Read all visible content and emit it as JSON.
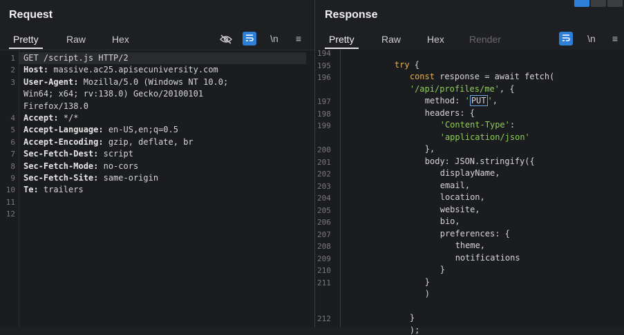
{
  "request": {
    "title": "Request",
    "tabs": [
      "Pretty",
      "Raw",
      "Hex"
    ],
    "active_tab": "Pretty",
    "toolbar": {
      "wrap_label": "\\n",
      "menu": "≡",
      "hide_icon": "eye-off-icon",
      "format_icon": "format-icon"
    },
    "lines": [
      {
        "n": "1",
        "key": "",
        "rest": "GET /script.js HTTP/2"
      },
      {
        "n": "2",
        "key": "Host:",
        "rest": " massive.ac25.apisecuniversity.com"
      },
      {
        "n": "3",
        "key": "User-Agent:",
        "rest": " Mozilla/5.0 (Windows NT 10.0;"
      },
      {
        "n": "",
        "key": "",
        "rest": "Win64; x64; rv:138.0) Gecko/20100101"
      },
      {
        "n": "",
        "key": "",
        "rest": "Firefox/138.0"
      },
      {
        "n": "4",
        "key": "Accept:",
        "rest": " */*"
      },
      {
        "n": "5",
        "key": "Accept-Language:",
        "rest": " en-US,en;q=0.5"
      },
      {
        "n": "6",
        "key": "Accept-Encoding:",
        "rest": " gzip, deflate, br"
      },
      {
        "n": "7",
        "key": "Sec-Fetch-Dest:",
        "rest": " script"
      },
      {
        "n": "8",
        "key": "Sec-Fetch-Mode:",
        "rest": " no-cors"
      },
      {
        "n": "9",
        "key": "Sec-Fetch-Site:",
        "rest": " same-origin"
      },
      {
        "n": "10",
        "key": "Te:",
        "rest": " trailers"
      },
      {
        "n": "11",
        "key": "",
        "rest": ""
      },
      {
        "n": "12",
        "key": "",
        "rest": ""
      }
    ]
  },
  "response": {
    "title": "Response",
    "tabs": [
      "Pretty",
      "Raw",
      "Hex",
      "Render"
    ],
    "active_tab": "Pretty",
    "toolbar": {
      "wrap_label": "\\n",
      "menu": "≡",
      "format_icon": "format-icon"
    },
    "lines": [
      {
        "n": "194",
        "indent": 0,
        "parts": []
      },
      {
        "n": "195",
        "indent": 8,
        "parts": [
          [
            "kw",
            "try"
          ],
          [
            "",
            " {"
          ]
        ]
      },
      {
        "n": "196",
        "indent": 12,
        "parts": [
          [
            "kw",
            "const"
          ],
          [
            "",
            " response = await fetch("
          ]
        ]
      },
      {
        "n": "",
        "indent": 12,
        "parts": [
          [
            "str",
            "'/api/profiles/me'"
          ],
          [
            "",
            ", {"
          ]
        ]
      },
      {
        "n": "197",
        "indent": 16,
        "parts": [
          [
            "",
            "method: "
          ],
          [
            "str",
            "'"
          ],
          [
            "cursor",
            "PUT"
          ],
          [
            "str",
            "'"
          ],
          [
            "",
            ","
          ]
        ]
      },
      {
        "n": "198",
        "indent": 16,
        "parts": [
          [
            "",
            "headers: {"
          ]
        ]
      },
      {
        "n": "199",
        "indent": 20,
        "parts": [
          [
            "str",
            "'Content-Type'"
          ],
          [
            "",
            ":"
          ]
        ]
      },
      {
        "n": "",
        "indent": 20,
        "parts": [
          [
            "str",
            "'application/json'"
          ]
        ]
      },
      {
        "n": "200",
        "indent": 16,
        "parts": [
          [
            "",
            "},"
          ]
        ]
      },
      {
        "n": "201",
        "indent": 16,
        "parts": [
          [
            "",
            "body: JSON.stringify({"
          ]
        ]
      },
      {
        "n": "202",
        "indent": 20,
        "parts": [
          [
            "",
            "displayName,"
          ]
        ]
      },
      {
        "n": "203",
        "indent": 20,
        "parts": [
          [
            "",
            "email,"
          ]
        ]
      },
      {
        "n": "204",
        "indent": 20,
        "parts": [
          [
            "",
            "location,"
          ]
        ]
      },
      {
        "n": "205",
        "indent": 20,
        "parts": [
          [
            "",
            "website,"
          ]
        ]
      },
      {
        "n": "206",
        "indent": 20,
        "parts": [
          [
            "",
            "bio,"
          ]
        ]
      },
      {
        "n": "207",
        "indent": 20,
        "parts": [
          [
            "",
            "preferences: {"
          ]
        ]
      },
      {
        "n": "208",
        "indent": 24,
        "parts": [
          [
            "",
            "theme,"
          ]
        ]
      },
      {
        "n": "209",
        "indent": 24,
        "parts": [
          [
            "",
            "notifications"
          ]
        ]
      },
      {
        "n": "210",
        "indent": 20,
        "parts": [
          [
            "",
            "}"
          ]
        ]
      },
      {
        "n": "211",
        "indent": 16,
        "parts": [
          [
            "",
            "}"
          ]
        ]
      },
      {
        "n": "",
        "indent": 16,
        "parts": [
          [
            "",
            ")"
          ]
        ]
      },
      {
        "n": "",
        "indent": 12,
        "parts": []
      },
      {
        "n": "212",
        "indent": 12,
        "parts": [
          [
            "",
            "}"
          ]
        ]
      },
      {
        "n": "",
        "indent": 12,
        "parts": [
          [
            "",
            ");"
          ]
        ]
      }
    ]
  },
  "layout_buttons": [
    "layout-side-by-side-icon",
    "layout-stacked-icon",
    "layout-single-icon"
  ]
}
